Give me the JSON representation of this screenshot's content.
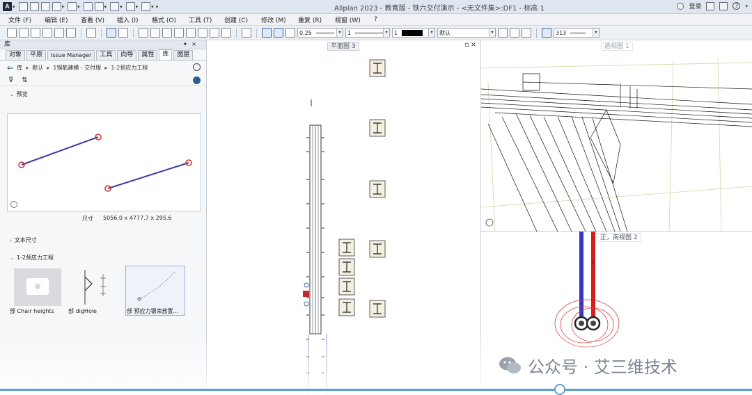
{
  "window": {
    "title": "Allplan 2023 - 教育版 - 铁六交付演示 - <无文件集>:DF1 - 标高 1",
    "login_label": "登录",
    "help_label": "?"
  },
  "menu": [
    {
      "label": "文件 (F)"
    },
    {
      "label": "编辑 (E)"
    },
    {
      "label": "查看 (V)"
    },
    {
      "label": "插入 (I)"
    },
    {
      "label": "格式 (O)"
    },
    {
      "label": "工具 (T)"
    },
    {
      "label": "创建 (C)"
    },
    {
      "label": "修改 (M)"
    },
    {
      "label": "重复 (R)"
    },
    {
      "label": "视窗 (W)"
    },
    {
      "label": "?"
    }
  ],
  "toolbar": {
    "pen_thickness": "0.25",
    "line_type": "1",
    "color": "1",
    "layer": "默认",
    "scale": "313"
  },
  "library": {
    "panel_title": "库",
    "tabs": [
      {
        "label": "对象",
        "active": false
      },
      {
        "label": "平原",
        "active": false
      },
      {
        "label": "Issue Manager",
        "active": false
      },
      {
        "label": "工具",
        "active": false
      },
      {
        "label": "向导",
        "active": false
      },
      {
        "label": "属性",
        "active": false
      },
      {
        "label": "库",
        "active": true
      },
      {
        "label": "图层",
        "active": false
      }
    ],
    "breadcrumb": [
      "库",
      "默认",
      "1铜筋建模 - 交付版",
      "1-2预应力工程"
    ],
    "preview_section": "预览",
    "size_label": "尺寸",
    "size_value": "5056.0 x 4777.7 x 295.6",
    "text_size_section": "文本尺寸",
    "folder_section": "1-2预应力工程",
    "items": [
      {
        "prefix": "部",
        "label": "Chair heights"
      },
      {
        "prefix": "部",
        "label": "digHole"
      },
      {
        "prefix": "部",
        "label": "预应力钢束放置..."
      }
    ]
  },
  "views": {
    "plan_label": "平面图 3",
    "perspective_label": "透视图 1",
    "front_label": "正，南视图 2"
  },
  "watermark": "公众号 · 艾三维技术"
}
